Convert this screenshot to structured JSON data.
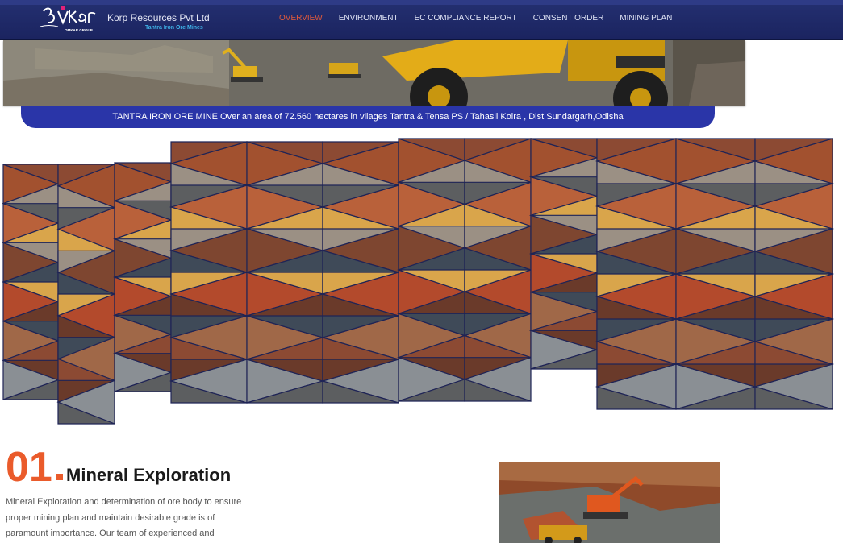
{
  "header": {
    "logo_text": "Omkar",
    "logo_tag": "OMKAR GROUP",
    "company": "Korp Resources Pvt Ltd",
    "subtitle": "Tantra Iron Ore Mines",
    "nav": [
      {
        "label": "OVERVIEW",
        "active": true
      },
      {
        "label": "ENVIRONMENT",
        "active": false
      },
      {
        "label": "EC COMPLIANCE REPORT",
        "active": false
      },
      {
        "label": "CONSENT ORDER",
        "active": false
      },
      {
        "label": "MINING PLAN",
        "active": false
      }
    ]
  },
  "banner": {
    "text": "TANTRA IRON ORE MINE Over an area of 72.560 hectares in vilages Tantra & Tensa PS / Tahasil Koira , Dist Sundargarh,Odisha"
  },
  "section": {
    "number": "01",
    "title": "Mineral Exploration",
    "text": "Mineral Exploration and determination of ore body to ensure proper mining plan and maintain desirable grade is of paramount importance. Our team of experienced and"
  },
  "colors": {
    "header_bg": "#1b2460",
    "nav_active": "#e35a3a",
    "banner_bg": "#2a35a8",
    "accent": "#ea5b2b",
    "subtitle": "#3fb3e8"
  }
}
